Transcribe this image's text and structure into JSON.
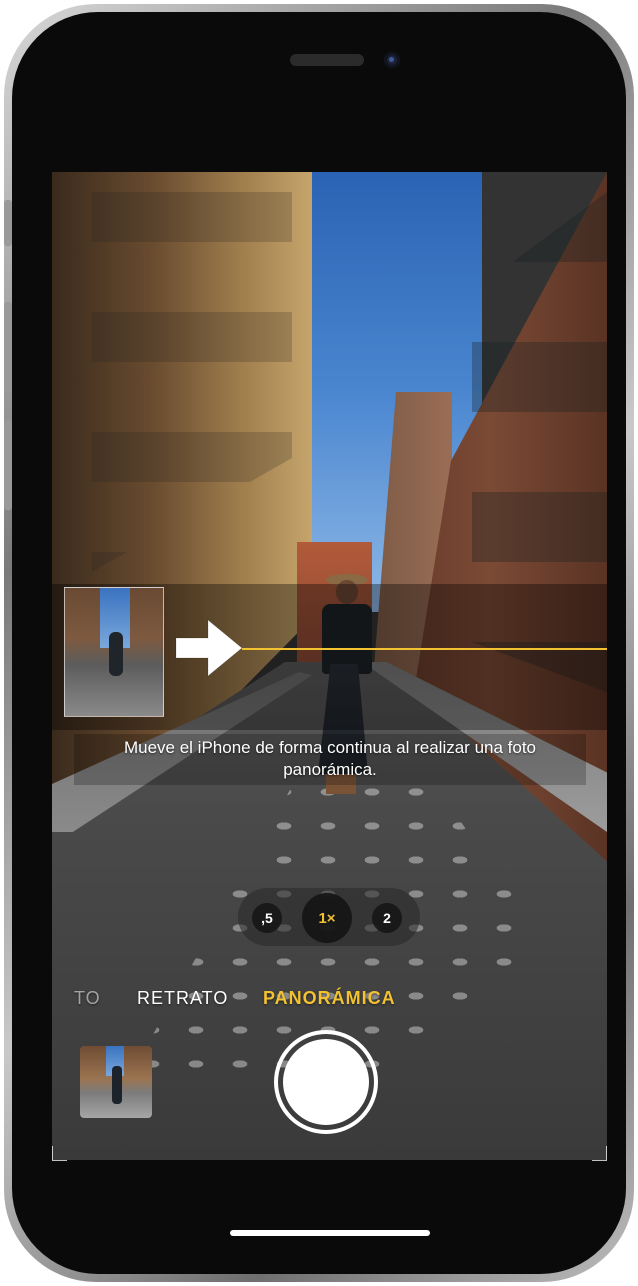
{
  "camera": {
    "hint_line1": "Mueve el iPhone de forma continua al realizar una foto",
    "hint_line2": "panorámica.",
    "zoom_options": [
      ",5",
      "1×",
      "2"
    ],
    "active_zoom": "1×",
    "modes": [
      "TO",
      "RETRATO",
      "PANORÁMICA"
    ],
    "active_mode": "PANORÁMICA",
    "accent_color": "#f2c230"
  },
  "icons": {
    "pan_direction": "arrow-right-icon",
    "shutter": "shutter-icon",
    "gallery": "last-photo-thumbnail"
  }
}
